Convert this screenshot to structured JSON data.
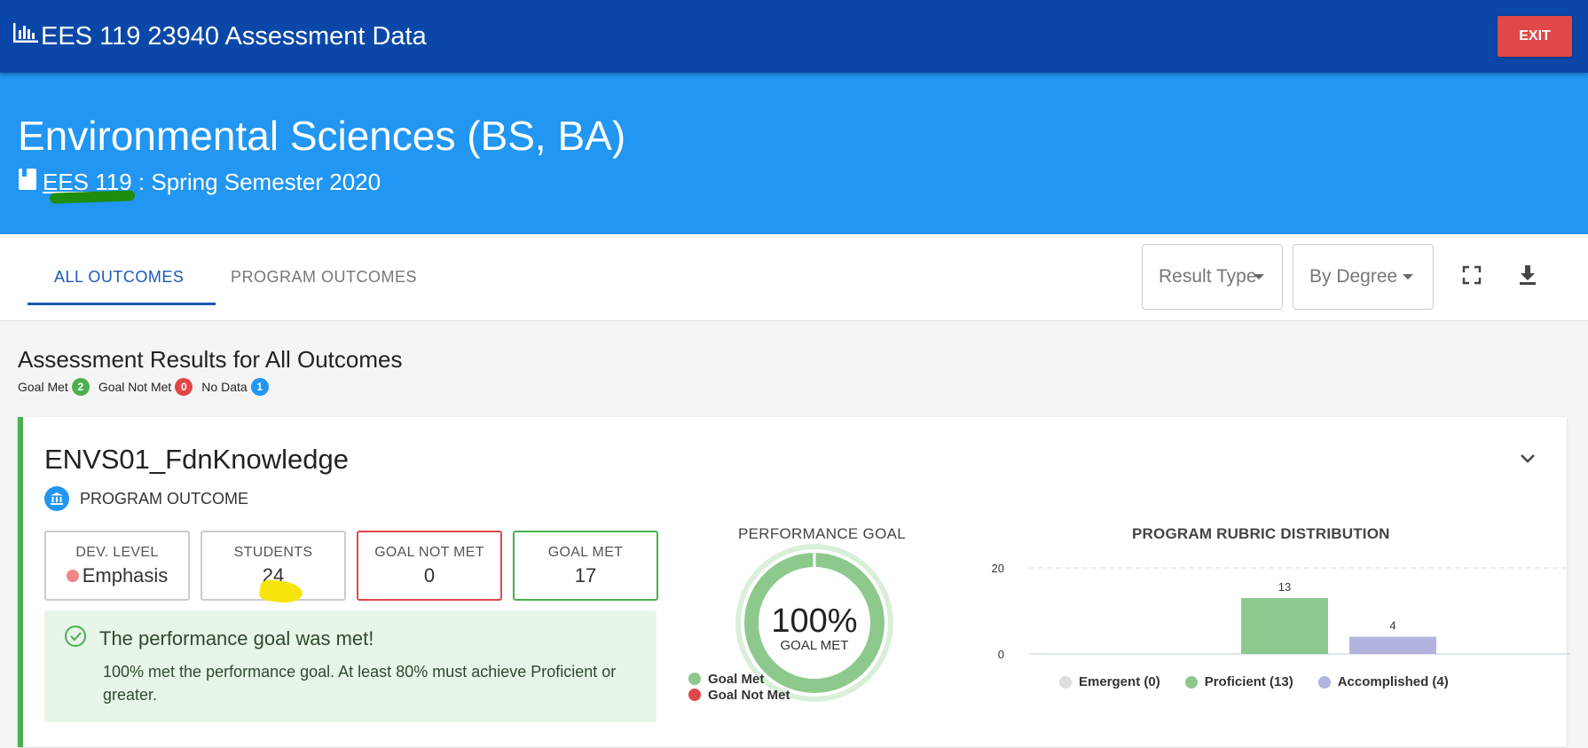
{
  "header": {
    "title": "EES 119 23940 Assessment Data",
    "exit_label": "EXIT"
  },
  "hero": {
    "program": "Environmental Sciences (BS, BA)",
    "course": "EES 119",
    "term": " : Spring Semester 2020"
  },
  "tabs": [
    {
      "label": "ALL OUTCOMES",
      "active": true
    },
    {
      "label": "PROGRAM OUTCOMES",
      "active": false
    }
  ],
  "filters": {
    "result_type": "Result Type",
    "by_degree": "By Degree"
  },
  "summary": {
    "title": "Assessment Results for All Outcomes",
    "goal_met_label": "Goal Met",
    "goal_met_count": "2",
    "goal_not_met_label": "Goal Not Met",
    "goal_not_met_count": "0",
    "no_data_label": "No Data",
    "no_data_count": "1"
  },
  "outcome": {
    "name": "ENVS01_FdnKnowledge",
    "type": "PROGRAM OUTCOME",
    "stats": {
      "dev_level_label": "DEV. LEVEL",
      "dev_level_value": "Emphasis",
      "students_label": "STUDENTS",
      "students_value": "24",
      "goal_not_met_label": "GOAL NOT MET",
      "goal_not_met_value": "0",
      "goal_met_label": "GOAL MET",
      "goal_met_value": "17"
    },
    "goal_message": {
      "heading": "The performance goal was met!",
      "text": "100% met the performance goal. At least 80% must achieve Proficient or greater."
    },
    "performance": {
      "title": "PERFORMANCE GOAL",
      "percent": "100%",
      "caption": "GOAL MET",
      "legend_met": "Goal Met",
      "legend_not_met": "Goal Not Met",
      "fraction_met": 1.0
    },
    "rubric": {
      "title": "PROGRAM RUBRIC DISTRIBUTION",
      "legend": [
        "Emergent (0)",
        "Proficient (13)",
        "Accomplished (4)"
      ]
    }
  },
  "colors": {
    "header": "#0a47a8",
    "hero": "#2196f3",
    "green": "#4caf50",
    "red": "#e04848",
    "blue": "#2196f3",
    "proficient": "#8dc98d",
    "accomplished": "#b3b3df",
    "emergent": "#dddddd"
  },
  "chart_data": {
    "type": "bar",
    "categories": [
      "Emergent",
      "Proficient",
      "Accomplished"
    ],
    "values": [
      0,
      13,
      4
    ],
    "title": "PROGRAM RUBRIC DISTRIBUTION",
    "ylim": [
      0,
      20
    ],
    "yticks": [
      0,
      20
    ],
    "colors": [
      "#dddddd",
      "#8dc98d",
      "#b3b3df"
    ],
    "grid": true,
    "legend": "bottom"
  }
}
